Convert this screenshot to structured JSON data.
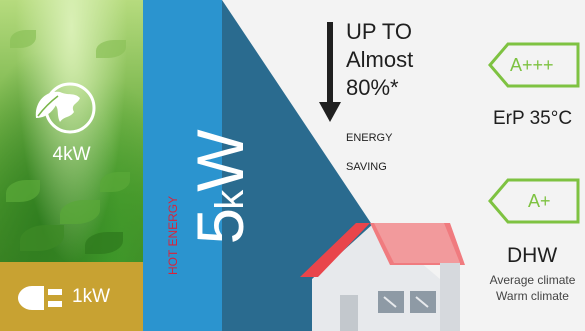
{
  "left_panel": {
    "eco_power": "4kW",
    "grid_power": "1kW",
    "icons": [
      "globe-leaf-icon",
      "plug-icon"
    ]
  },
  "energy_band": {
    "total": "5",
    "total_unit_prefix": "k",
    "total_unit": "W",
    "label": "HOT ENERGY"
  },
  "saving": {
    "line1": "UP TO",
    "line2": "Almost",
    "line3": "80%*",
    "line4": "ENERGY",
    "line5": "SAVING"
  },
  "ratings": {
    "erp_badge": "A+++",
    "erp_label": "ErP  35°C",
    "dhw_badge": "A+",
    "dhw_label": "DHW",
    "climate1": "Average climate",
    "climate2": "Warm climate"
  },
  "colors": {
    "blue": "#2b94cf",
    "dark_blue": "#2a6b8f",
    "gold": "#c8a232",
    "rating_green": "#7ec241",
    "hot_red": "#d8243b",
    "roof_red": "#e9454b"
  }
}
